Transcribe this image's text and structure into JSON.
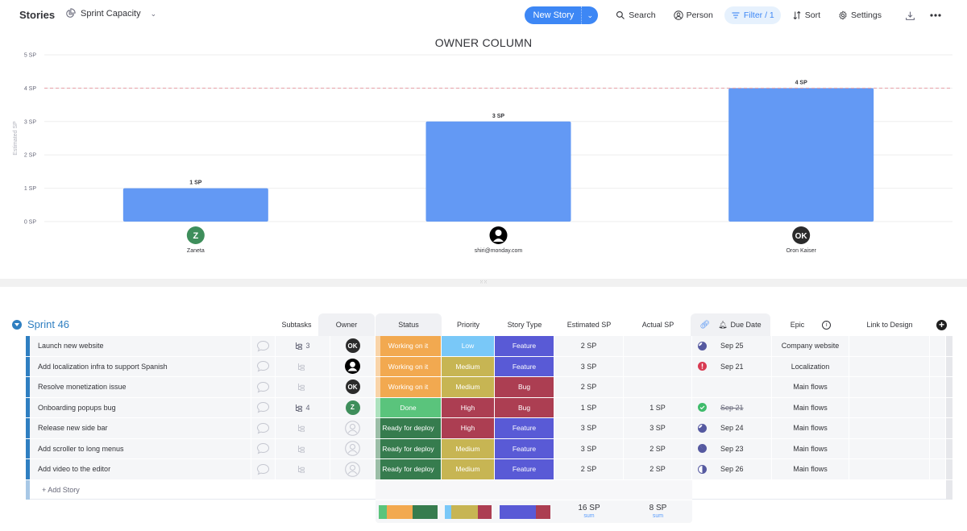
{
  "header": {
    "board_title": "Stories",
    "view_name": "Sprint Capacity",
    "view_icon": "pie-chart-icon",
    "new_story_label": "New Story",
    "search_label": "Search",
    "person_label": "Person",
    "filter_label": "Filter / 1",
    "sort_label": "Sort",
    "settings_label": "Settings",
    "accent_color": "#3d87f5"
  },
  "chart_data": {
    "type": "bar",
    "title": "OWNER COLUMN",
    "xlabel": "",
    "ylabel": "Estimated SP",
    "ylim": [
      0,
      5
    ],
    "yticks": [
      "0 SP",
      "1 SP",
      "2 SP",
      "3 SP",
      "4 SP",
      "5 SP"
    ],
    "categories": [
      "Zaneta",
      "shiri@monday.com",
      "Oron Kaiser"
    ],
    "values": [
      1,
      3,
      4
    ],
    "data_labels": [
      "1 SP",
      "3 SP",
      "4 SP"
    ],
    "owner_avatars": [
      {
        "type": "initials",
        "text": "Z",
        "color": "#3e8e5b"
      },
      {
        "type": "person-icon",
        "text": "",
        "color": "#000000"
      },
      {
        "type": "initials",
        "text": "OK",
        "color": "#2b2b2b"
      }
    ],
    "capacity_line": {
      "value": 4,
      "style": "dashed",
      "color": "#e8a0a6"
    },
    "bar_color": "#6399f4",
    "grid": true
  },
  "group": {
    "title": "Sprint 46",
    "color": "#2f7fc1",
    "columns": [
      "Subtasks",
      "Owner",
      "Status",
      "Priority",
      "Story Type",
      "Estimated SP",
      "Actual SP",
      "Due Date",
      "Epic",
      "Link to Design"
    ],
    "rows": [
      {
        "name": "Launch new website",
        "subtasks": "3",
        "owner": {
          "type": "initials",
          "text": "OK"
        },
        "status": "Working on it",
        "priority": "Low",
        "story_type": "Feature",
        "estimated_sp": "2 SP",
        "actual_sp": "",
        "due_icon": "progress-75",
        "due_date": "Sep 25",
        "due_done": false,
        "epic": "Company website",
        "link": ""
      },
      {
        "name": "Add localization infra to support Spanish",
        "subtasks": "",
        "owner": {
          "type": "person-icon",
          "text": ""
        },
        "status": "Working on it",
        "priority": "Medium",
        "story_type": "Feature",
        "estimated_sp": "3 SP",
        "actual_sp": "",
        "due_icon": "overdue",
        "due_date": "Sep 21",
        "due_done": false,
        "epic": "Localization",
        "link": ""
      },
      {
        "name": "Resolve monetization issue",
        "subtasks": "",
        "owner": {
          "type": "initials",
          "text": "OK"
        },
        "status": "Working on it",
        "priority": "Medium",
        "story_type": "Bug",
        "estimated_sp": "2 SP",
        "actual_sp": "",
        "due_icon": "",
        "due_date": "",
        "due_done": false,
        "epic": "Main flows",
        "link": ""
      },
      {
        "name": "Onboarding popups bug",
        "subtasks": "4",
        "owner": {
          "type": "initials",
          "text": "Z"
        },
        "status": "Done",
        "priority": "High",
        "story_type": "Bug",
        "estimated_sp": "1 SP",
        "actual_sp": "1 SP",
        "due_icon": "done",
        "due_date": "Sep 21",
        "due_done": true,
        "epic": "Main flows",
        "link": ""
      },
      {
        "name": "Release new side bar",
        "subtasks": "",
        "owner": {
          "type": "empty",
          "text": ""
        },
        "status": "Ready for deploy",
        "priority": "High",
        "story_type": "Feature",
        "estimated_sp": "3 SP",
        "actual_sp": "3 SP",
        "due_icon": "progress-75",
        "due_date": "Sep 24",
        "due_done": false,
        "epic": "Main flows",
        "link": ""
      },
      {
        "name": "Add scroller to long menus",
        "subtasks": "",
        "owner": {
          "type": "empty",
          "text": ""
        },
        "status": "Ready for deploy",
        "priority": "Medium",
        "story_type": "Feature",
        "estimated_sp": "3 SP",
        "actual_sp": "2 SP",
        "due_icon": "progress-90",
        "due_date": "Sep 23",
        "due_done": false,
        "epic": "Main flows",
        "link": ""
      },
      {
        "name": "Add video to the editor",
        "subtasks": "",
        "owner": {
          "type": "empty",
          "text": ""
        },
        "status": "Ready for deploy",
        "priority": "Medium",
        "story_type": "Feature",
        "estimated_sp": "2 SP",
        "actual_sp": "2 SP",
        "due_icon": "progress-50",
        "due_date": "Sep 26",
        "due_done": false,
        "epic": "Main flows",
        "link": ""
      }
    ],
    "add_label": "+ Add Story",
    "summary": {
      "status_dist": [
        {
          "label": "Done",
          "count": 1
        },
        {
          "label": "Working on it",
          "count": 3
        },
        {
          "label": "Ready for deploy",
          "count": 3
        }
      ],
      "priority_dist": [
        {
          "label": "Low",
          "count": 1
        },
        {
          "label": "Medium",
          "count": 4
        },
        {
          "label": "High",
          "count": 2
        }
      ],
      "type_dist": [
        {
          "label": "Feature",
          "count": 5
        },
        {
          "label": "Bug",
          "count": 2
        }
      ],
      "estimated_total": "16 SP",
      "actual_total": "8 SP",
      "agg_label": "sum"
    }
  },
  "colors": {
    "Working on it": "#f2a950",
    "Done": "#5ac47c",
    "Ready for deploy": "#367c4e",
    "Low": "#79c8f8",
    "Medium": "#c7b553",
    "High": "#ac3e52",
    "Feature": "#595ad6",
    "Bug": "#ac3e52"
  }
}
